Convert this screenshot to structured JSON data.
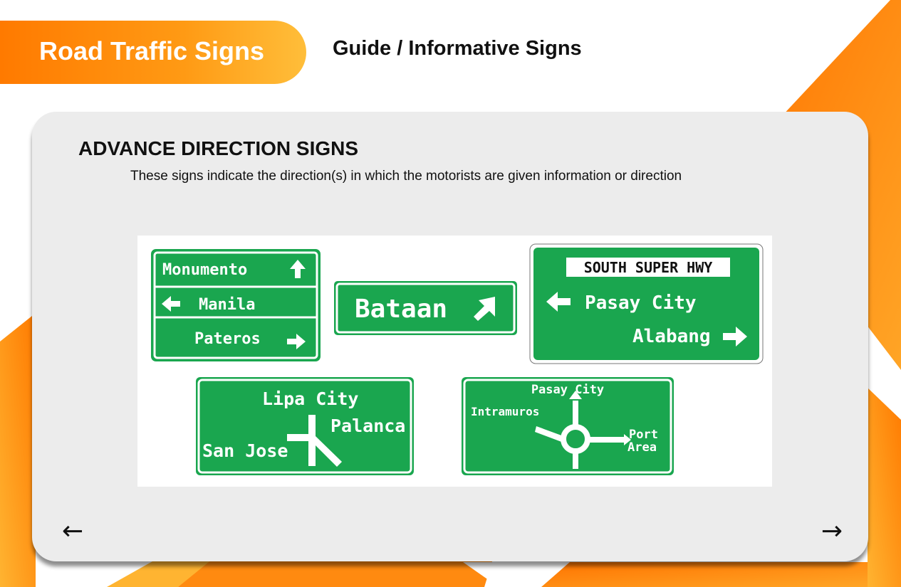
{
  "header": {
    "title": "Road Traffic Signs",
    "subtitle": "Guide / Informative Signs"
  },
  "section": {
    "title": "ADVANCE DIRECTION SIGNS",
    "description": "These signs indicate the direction(s) in which the motorists are given information or direction"
  },
  "signs": {
    "sign1": {
      "row1": "Monumento",
      "row2": "Manila",
      "row3": "Pateros"
    },
    "sign2": {
      "label": "Bataan"
    },
    "sign3": {
      "banner": "SOUTH SUPER HWY",
      "row1": "Pasay City",
      "row2": "Alabang"
    },
    "sign4": {
      "top": "Lipa City",
      "right": "Palanca",
      "left": "San Jose"
    },
    "sign5": {
      "top": "Pasay City",
      "left": "Intramuros",
      "right1": "Port",
      "right2": "Area"
    }
  },
  "navigation": {
    "prev": "←",
    "next": "→"
  },
  "colors": {
    "accent_orange": "#ff7a00",
    "accent_light": "#ffbe3a",
    "sign_green": "#1aa64f",
    "card_bg": "#ececec"
  },
  "icons": [
    "arrow-up-icon",
    "arrow-left-icon",
    "arrow-right-icon",
    "arrow-up-right-icon",
    "roundabout-icon",
    "junction-icon"
  ]
}
